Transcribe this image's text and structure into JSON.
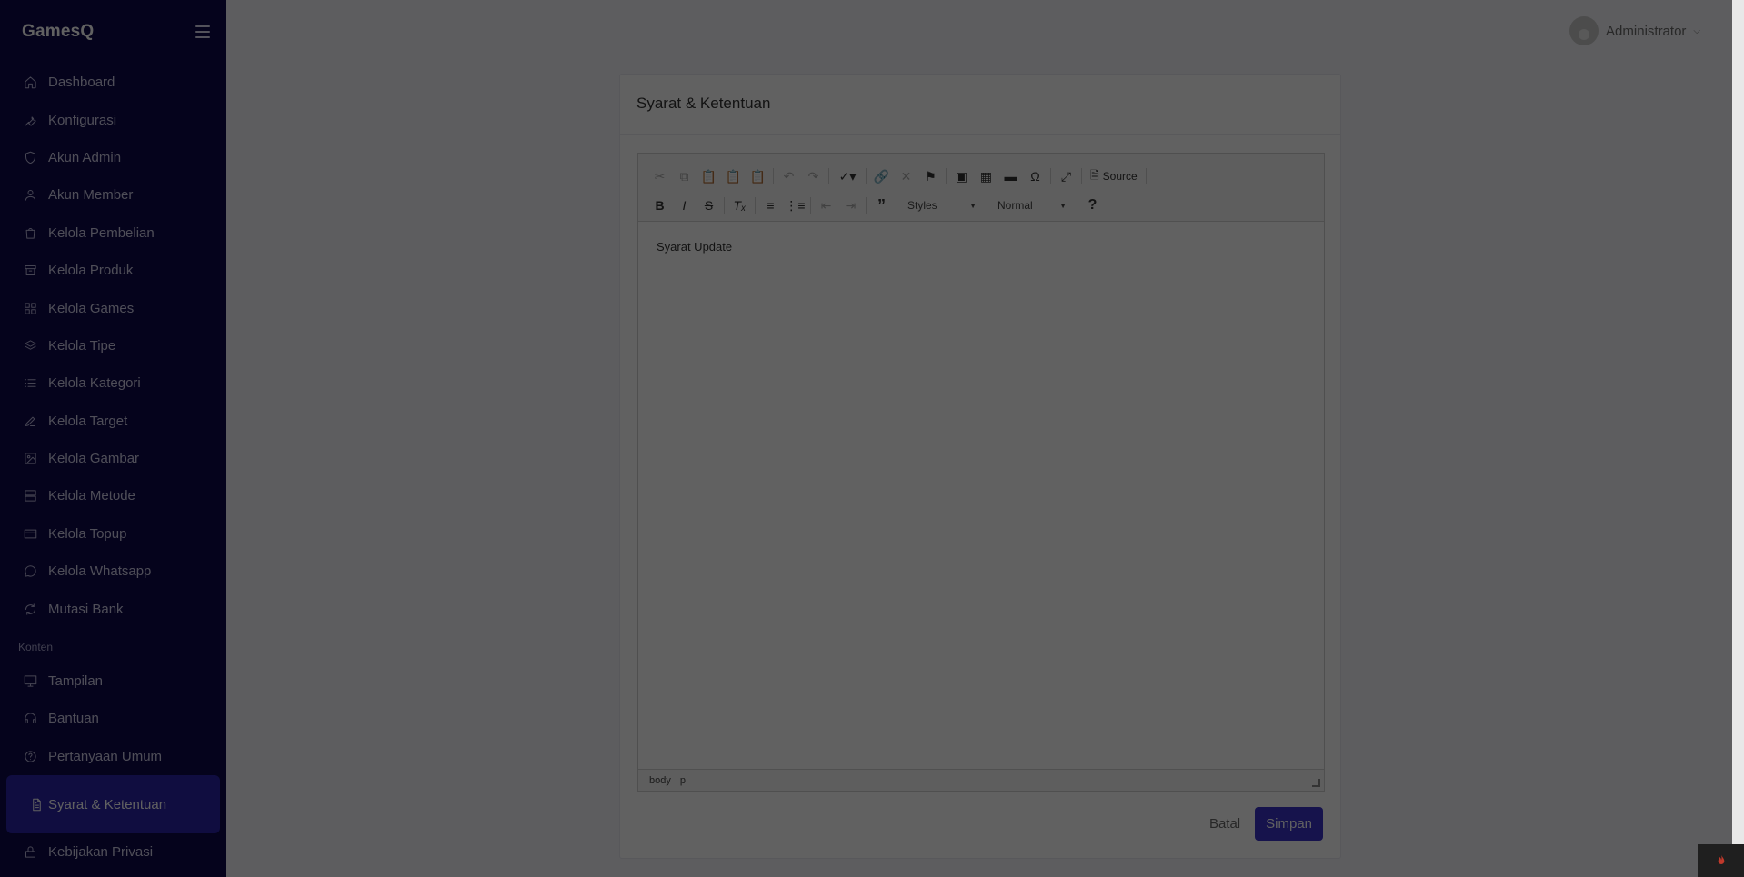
{
  "brand": "GamesQ",
  "sidebar": {
    "items": [
      {
        "label": "Dashboard",
        "icon": "home-icon"
      },
      {
        "label": "Konfigurasi",
        "icon": "wrench-icon"
      },
      {
        "label": "Akun Admin",
        "icon": "shield-icon"
      },
      {
        "label": "Akun Member",
        "icon": "user-icon"
      },
      {
        "label": "Kelola Pembelian",
        "icon": "shopping-bag-icon"
      },
      {
        "label": "Kelola Produk",
        "icon": "archive-icon"
      },
      {
        "label": "Kelola Games",
        "icon": "grid-icon"
      },
      {
        "label": "Kelola Tipe",
        "icon": "layers-icon"
      },
      {
        "label": "Kelola Kategori",
        "icon": "list-icon"
      },
      {
        "label": "Kelola Target",
        "icon": "pencil-icon"
      },
      {
        "label": "Kelola Gambar",
        "icon": "image-icon"
      },
      {
        "label": "Kelola Metode",
        "icon": "server-icon"
      },
      {
        "label": "Kelola Topup",
        "icon": "credit-card-icon"
      },
      {
        "label": "Kelola Whatsapp",
        "icon": "message-circle-icon"
      },
      {
        "label": "Mutasi Bank",
        "icon": "refresh-icon"
      }
    ],
    "section_label": "Konten",
    "content_items": [
      {
        "label": "Tampilan",
        "icon": "monitor-icon"
      },
      {
        "label": "Bantuan",
        "icon": "headphones-icon"
      },
      {
        "label": "Pertanyaan Umum",
        "icon": "help-circle-icon"
      },
      {
        "label": "Syarat & Ketentuan",
        "icon": "file-text-icon",
        "active": true
      },
      {
        "label": "Kebijakan Privasi",
        "icon": "lock-icon"
      }
    ]
  },
  "topbar": {
    "user_name": "Administrator"
  },
  "card": {
    "title": "Syarat & Ketentuan"
  },
  "editor": {
    "source_label": "Source",
    "styles_label": "Styles",
    "format_label": "Normal",
    "content": "Syarat Update",
    "path": [
      "body",
      "p"
    ]
  },
  "actions": {
    "cancel_label": "Batal",
    "save_label": "Simpan"
  },
  "colors": {
    "sidebar_bg": "#0f0a4a",
    "accent": "#3b34c9",
    "active_item": "#2a23a8"
  }
}
